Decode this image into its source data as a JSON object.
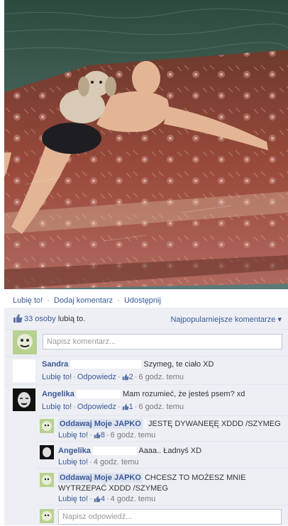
{
  "actions": {
    "like": "Lubię to!",
    "comment": "Dodaj komentarz",
    "share": "Udostępnij",
    "separator": "·"
  },
  "likes": {
    "count": "33 osoby",
    "suffix": "lubią to.",
    "sort": "Najpopularniejsze komentarze ▾"
  },
  "composer": {
    "placeholder": "Napisz komentarz..."
  },
  "comments": [
    {
      "author": "Sandra",
      "text": "Szymeg, te ciało XD",
      "like": "Lubię to!",
      "reply": "Odpowiedz",
      "likes": "2",
      "time": "6 godz. temu"
    },
    {
      "author": "Angelika",
      "text": "Mam rozumieć, że jesteś psem? xd",
      "like": "Lubię to!",
      "reply": "Odpowiedz",
      "likes": "1",
      "time": "6 godz. temu",
      "replies": [
        {
          "author": "Oddawaj Moje JAPKO",
          "text": "JESTĘ DYWANEĘĘ XDDD /SZYMEG",
          "like": "Lubię to!",
          "likes": "8",
          "time": "6 godz. temu"
        },
        {
          "author": "Angelika",
          "text": "Aaaa.. Ładnyś XD",
          "like": "Lubię to!",
          "time": "4 godz. temu"
        },
        {
          "author": "Oddawaj Moje JAPKO",
          "text_line1": "CHCESZ TO MOŻESZ MNIE",
          "text_line2": "WYTRZEPAĆ XDDD /SZYMEG",
          "like": "Lubię to!",
          "likes": "4",
          "time": "4 godz. temu"
        }
      ]
    }
  ],
  "reply_composer": {
    "placeholder": "Napisz odpowiedź..."
  },
  "colors": {
    "link": "#3b5998",
    "ufi_background": "#edeff4",
    "water": "#3f5a4a",
    "carpet": "#8a3b34"
  },
  "photo": {
    "icon": "photo-of-man-with-dog-on-floating-carpet"
  }
}
